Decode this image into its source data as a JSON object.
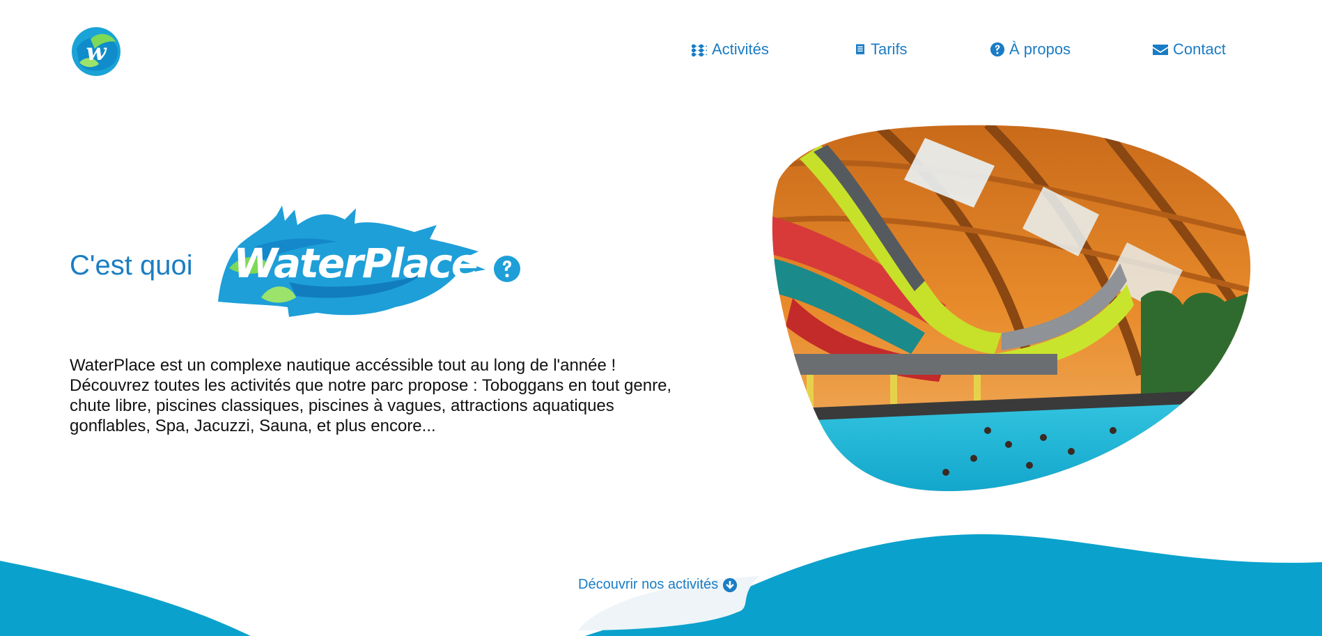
{
  "header": {
    "logo": {
      "letter": "w",
      "name": "waterplace-logo"
    },
    "nav": [
      {
        "label": "Activités",
        "icon": "waves-icon"
      },
      {
        "label": "Tarifs",
        "icon": "receipt-icon"
      },
      {
        "label": "À propos",
        "icon": "question-circle-icon"
      },
      {
        "label": "Contact",
        "icon": "envelope-icon"
      }
    ]
  },
  "hero": {
    "lead": "C'est quoi",
    "brand": "WaterPlace",
    "description": "WaterPlace est un complexe nautique accéssible tout au long de l'année ! Découvrez toutes les activités que notre parc propose : Toboggans en tout genre, chute libre, piscines classiques, piscines à vagues, attractions aquatiques gonflables, Spa, Jacuzzi, Sauna, et plus encore..."
  },
  "cta": {
    "label": "Découvrir nos activités",
    "icon": "arrow-down-circle-icon"
  },
  "colors": {
    "primary": "#1a7cc4",
    "wave": "#0aa2cc",
    "splash": "#1e9fd8",
    "leaf": "#7ed957"
  }
}
